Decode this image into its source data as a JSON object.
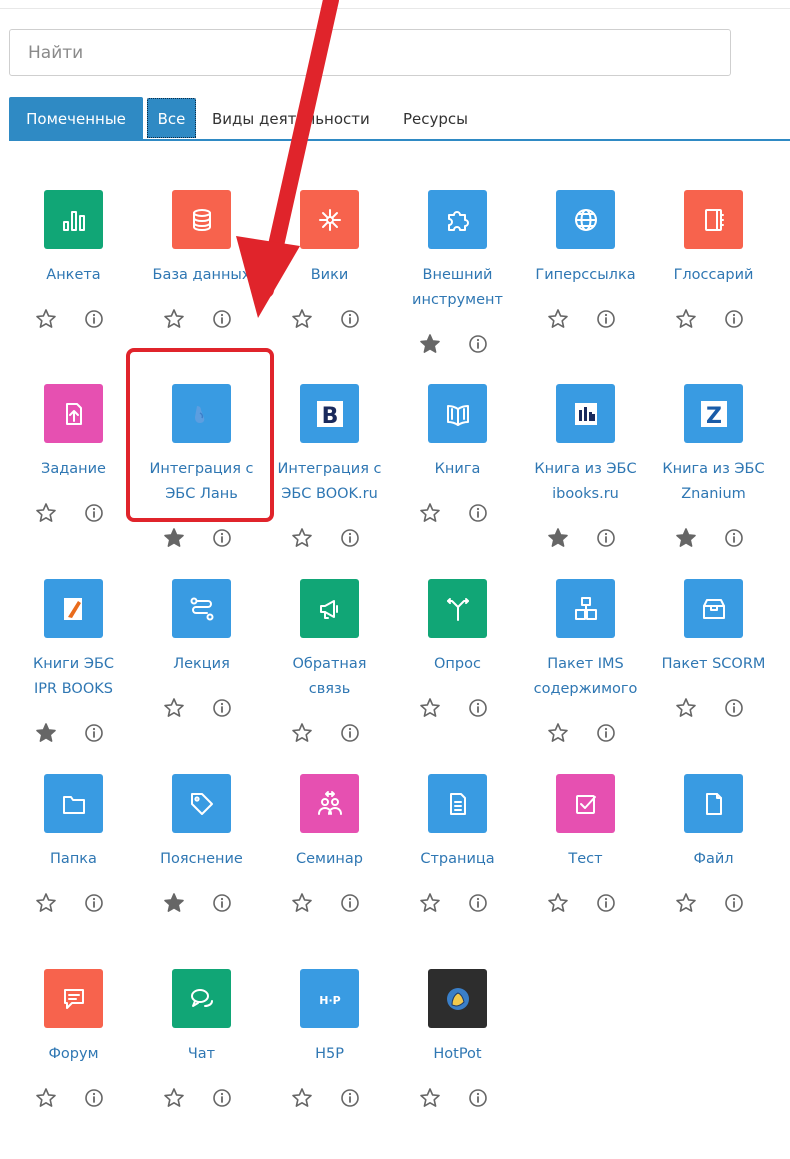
{
  "search": {
    "placeholder": "Найти"
  },
  "tabs": {
    "starred": "Помеченные",
    "all": "Все",
    "activities": "Виды деятельности",
    "resources": "Ресурсы"
  },
  "colors": {
    "blue": "#399be2",
    "red": "#f7634d",
    "green": "#11a676",
    "pink": "#f6a2ad",
    "magenta": "#e650b1",
    "dark": "#2d2d2d",
    "tab": "#2f8ac4",
    "link": "#2f77b3",
    "highlight": "#e0242b"
  },
  "modules": [
    {
      "lines": [
        "Анкета"
      ],
      "icon": "bar-chart-icon",
      "color": "green",
      "starred": false
    },
    {
      "lines": [
        "База данных"
      ],
      "icon": "database-icon",
      "color": "red",
      "starred": false
    },
    {
      "lines": [
        "Вики"
      ],
      "icon": "network-icon",
      "color": "red",
      "starred": false
    },
    {
      "lines": [
        "Внешний",
        "инструмент"
      ],
      "icon": "puzzle-icon",
      "color": "blue",
      "starred": true
    },
    {
      "lines": [
        "Гиперссылка"
      ],
      "icon": "globe-icon",
      "color": "blue",
      "starred": false
    },
    {
      "lines": [
        "Глоссарий"
      ],
      "icon": "notebook-icon",
      "color": "red",
      "starred": false
    },
    {
      "lines": [
        "Задание"
      ],
      "icon": "upload-file-icon",
      "color": "magenta",
      "starred": false
    },
    {
      "lines": [
        "Интеграция с",
        "ЭБС Лань"
      ],
      "icon": "lan-logo-icon",
      "color": "blue",
      "starred": true
    },
    {
      "lines": [
        "Интеграция с",
        "ЭБС BOOK.ru"
      ],
      "icon": "book-ru-logo-icon",
      "color": "blue",
      "starred": false
    },
    {
      "lines": [
        "Книга"
      ],
      "icon": "open-book-icon",
      "color": "blue",
      "starred": false
    },
    {
      "lines": [
        "Книга из ЭБС",
        "ibooks.ru"
      ],
      "icon": "ibooks-logo-icon",
      "color": "blue",
      "starred": true
    },
    {
      "lines": [
        "Книга из ЭБС",
        "Znanium"
      ],
      "icon": "znanium-logo-icon",
      "color": "blue",
      "starred": true
    },
    {
      "lines": [
        "Книги ЭБС",
        "IPR BOOKS"
      ],
      "icon": "ipr-books-logo-icon",
      "color": "blue",
      "starred": true
    },
    {
      "lines": [
        "Лекция"
      ],
      "icon": "route-icon",
      "color": "blue",
      "starred": false
    },
    {
      "lines": [
        "Обратная",
        "связь"
      ],
      "icon": "megaphone-icon",
      "color": "green",
      "starred": false
    },
    {
      "lines": [
        "Опрос"
      ],
      "icon": "signpost-icon",
      "color": "green",
      "starred": false
    },
    {
      "lines": [
        "Пакет IMS",
        "содержимого"
      ],
      "icon": "boxes-icon",
      "color": "blue",
      "starred": false
    },
    {
      "lines": [
        "Пакет SCORM"
      ],
      "icon": "box-icon",
      "color": "blue",
      "starred": false
    },
    {
      "lines": [
        "Папка"
      ],
      "icon": "folder-icon",
      "color": "blue",
      "starred": false
    },
    {
      "lines": [
        "Пояснение"
      ],
      "icon": "tag-icon",
      "color": "blue",
      "starred": true
    },
    {
      "lines": [
        "Семинар"
      ],
      "icon": "people-icon",
      "color": "magenta",
      "starred": false
    },
    {
      "lines": [
        "Страница"
      ],
      "icon": "page-icon",
      "color": "blue",
      "starred": false
    },
    {
      "lines": [
        "Тест"
      ],
      "icon": "checkbox-icon",
      "color": "magenta",
      "starred": false
    },
    {
      "lines": [
        "Файл"
      ],
      "icon": "file-icon",
      "color": "blue",
      "starred": false
    },
    {
      "lines": [
        "Форум"
      ],
      "icon": "message-icon",
      "color": "red",
      "starred": false
    },
    {
      "lines": [
        "Чат"
      ],
      "icon": "chat-bubbles-icon",
      "color": "green",
      "starred": false
    },
    {
      "lines": [
        "H5P"
      ],
      "icon": "h5p-logo-icon",
      "color": "blue",
      "starred": false
    },
    {
      "lines": [
        "HotPot"
      ],
      "icon": "hotpot-logo-icon",
      "color": "dark",
      "starred": false
    }
  ]
}
